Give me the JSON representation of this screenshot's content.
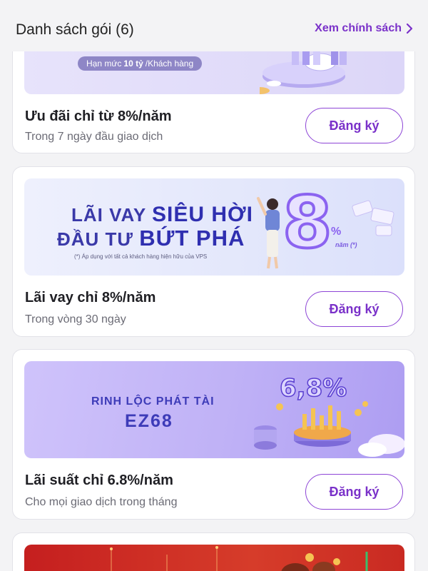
{
  "header": {
    "title": "Danh sách gói (6)",
    "policy_link": "Xem chính sách"
  },
  "packages": [
    {
      "banner_text": {
        "limit_prefix": "Hạn mức",
        "limit_value": "10 tỷ",
        "limit_suffix": "/Khách hàng"
      },
      "title": "Ưu đãi chỉ từ 8%/năm",
      "subtitle": "Trong 7 ngày đầu giao dịch",
      "button": "Đăng ký"
    },
    {
      "banner_text": {
        "line1_a": "LÃI VAY",
        "line1_b": "SIÊU HỜI",
        "line2_a": "ĐẦU TƯ",
        "line2_b": "BỨT PHÁ",
        "note": "(*) Áp dụng với tất cả khách hàng hiện hữu của VPS",
        "rate_big": "8",
        "rate_percent": "%",
        "rate_small": "năm (*)"
      },
      "title": "Lãi vay chỉ 8%/năm",
      "subtitle": "Trong vòng 30 ngày",
      "button": "Đăng ký"
    },
    {
      "banner_text": {
        "line1": "RINH LỘC PHÁT TÀI",
        "line2": "EZ68",
        "rate": "6,8%"
      },
      "title": "Lãi suất chỉ 6.8%/năm",
      "subtitle": "Cho mọi giao dịch trong tháng",
      "button": "Đăng ký"
    },
    {
      "banner_text": {}
    }
  ],
  "colors": {
    "accent": "#7a31c9",
    "background": "#f3f3f5",
    "card": "#ffffff"
  }
}
